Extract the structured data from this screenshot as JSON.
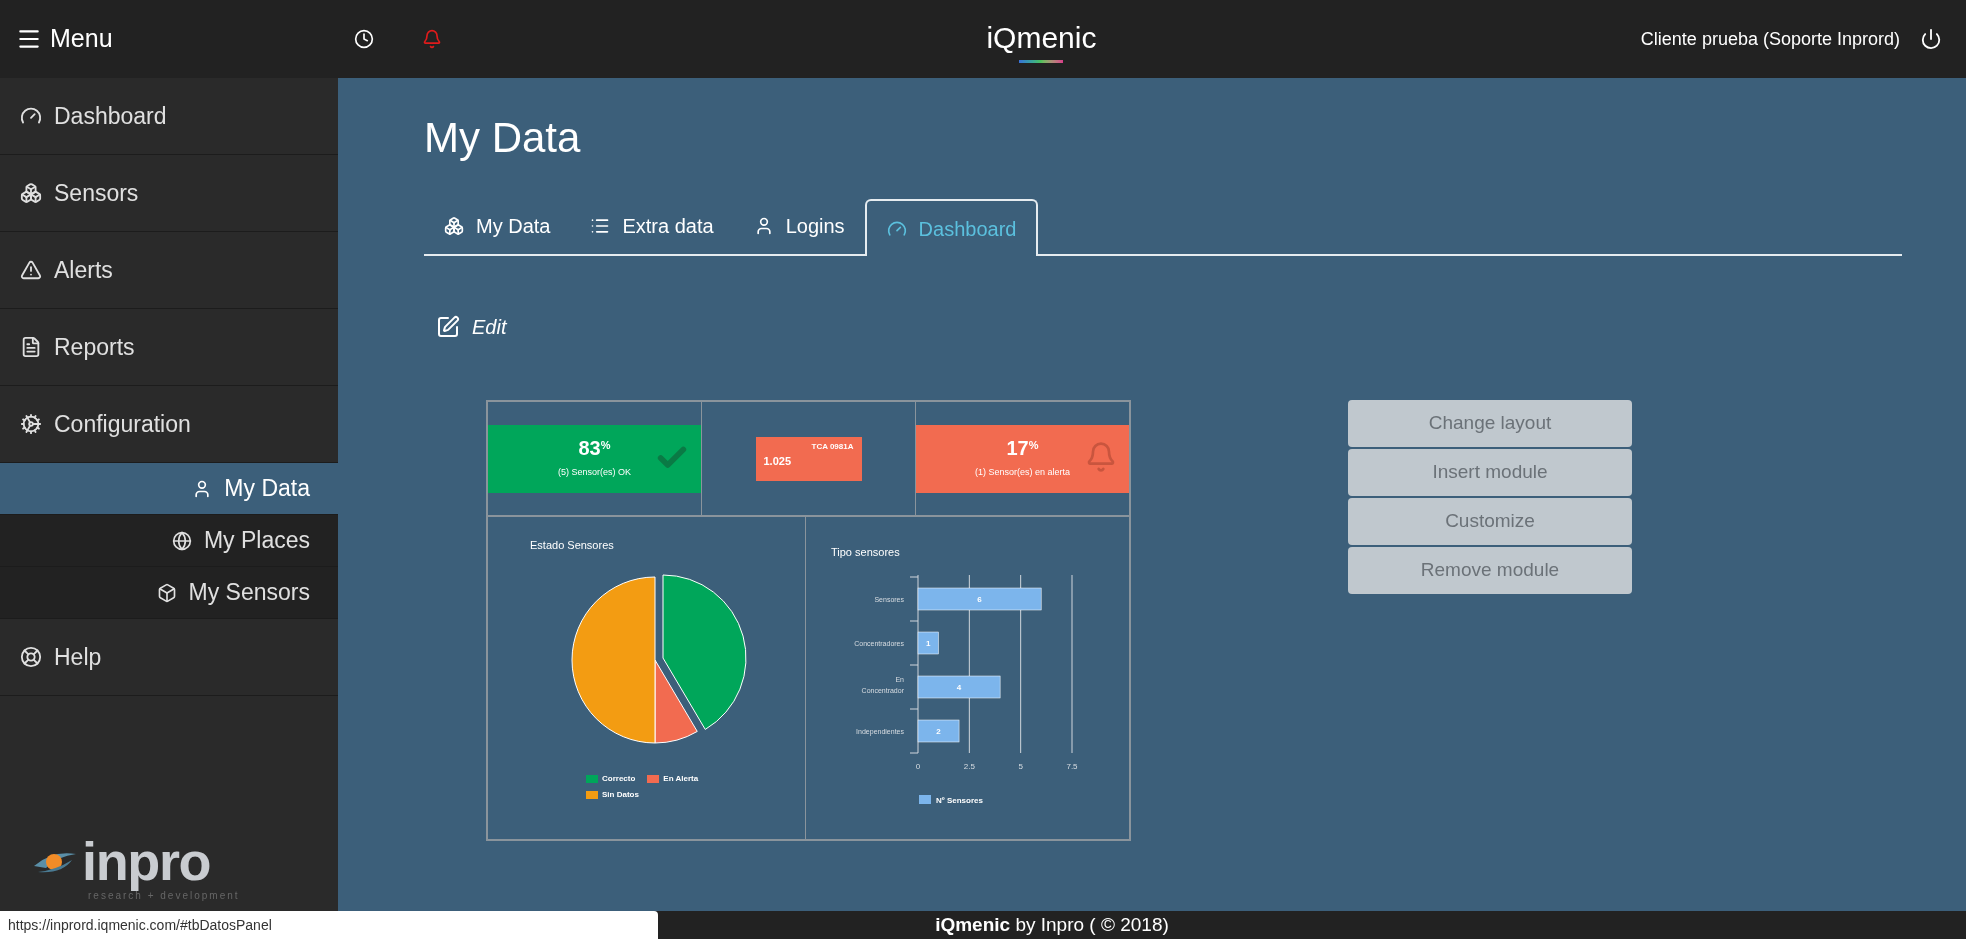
{
  "topbar": {
    "menu_label": "Menu",
    "title": "iQmenic",
    "user": "Cliente prueba (Soporte Inprord)"
  },
  "sidebar": {
    "items": [
      {
        "label": "Dashboard",
        "kind": "dashboard",
        "selected": false
      },
      {
        "label": "Sensors",
        "kind": "sensors",
        "selected": false
      },
      {
        "label": "Alerts",
        "kind": "alerts",
        "selected": false
      },
      {
        "label": "Reports",
        "kind": "reports",
        "selected": false
      },
      {
        "label": "Configuration",
        "kind": "config",
        "selected": false,
        "children": [
          {
            "label": "My Data",
            "kind": "user",
            "selected": true
          },
          {
            "label": "My Places",
            "kind": "globe",
            "selected": false
          },
          {
            "label": "My Sensors",
            "kind": "box",
            "selected": false
          }
        ]
      },
      {
        "label": "Help",
        "kind": "help",
        "selected": false
      }
    ],
    "logo": {
      "name": "inpro",
      "tagline": "research + development"
    }
  },
  "page": {
    "title": "My Data",
    "tabs": [
      {
        "label": "My Data",
        "kind": "sensors",
        "selected": false
      },
      {
        "label": "Extra data",
        "kind": "list",
        "selected": false
      },
      {
        "label": "Logins",
        "kind": "user",
        "selected": false
      },
      {
        "label": "Dashboard",
        "kind": "dashboard",
        "selected": true
      }
    ],
    "edit_label": "Edit",
    "widgets": [
      {
        "kind": "ok",
        "color": "#00a65a",
        "value": "83",
        "unit": "%",
        "caption": "(5) Sensor(es) OK"
      },
      {
        "kind": "sensor",
        "color": "#f26b50",
        "title": "TCA 0981A",
        "value": "1.025"
      },
      {
        "kind": "alert",
        "color": "#f26b50",
        "value": "17",
        "unit": "%",
        "caption": "(1) Sensor(es) en alerta"
      }
    ],
    "pie": {
      "title": "Estado Sensores",
      "legend": [
        {
          "label": "Correcto",
          "color": "#00a65a"
        },
        {
          "label": "En Alerta",
          "color": "#f26b50"
        },
        {
          "label": "Sin Datos",
          "color": "#f39c12"
        }
      ]
    },
    "bar": {
      "chart_data": {
        "type": "bar",
        "orientation": "horizontal",
        "title": "Tipo sensores",
        "categories": [
          "Sensores",
          "Concentradores",
          "En Concentrador",
          "Independientes"
        ],
        "series": [
          {
            "name": "Nº Sensores",
            "color": "#7cb5ec",
            "values": [
              6,
              1,
              4,
              2
            ]
          }
        ],
        "xlim": [
          0,
          7.5
        ],
        "xticks": [
          0,
          {
            "value": 2.5,
            "label": "2.5"
          },
          5,
          {
            "value": 7.5,
            "label": "7.5"
          }
        ],
        "data_labels": true
      }
    },
    "actions": [
      "Change layout",
      "Insert module",
      "Customize",
      "Remove module"
    ]
  },
  "status": {
    "url": "https://inprord.iqmenic.com/#tbDatosPanel",
    "footer": "**iQmenic** by Inpro ( © 2018)"
  }
}
